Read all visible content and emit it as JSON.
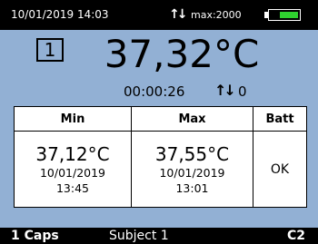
{
  "status_bar": {
    "datetime": "10/01/2019  14:03",
    "arrows": "↑↓",
    "max_label": "max:2000",
    "battery_level": 0.7,
    "battery_color": "#2fd12f"
  },
  "main": {
    "channel": "1",
    "temperature": "37,32°C",
    "timer": "00:00:26",
    "counter_arrows": "↑↓",
    "counter_value": "0"
  },
  "table": {
    "headers": [
      "Min",
      "Max",
      "Batt"
    ],
    "min": {
      "temp": "37,12°C",
      "date": "10/01/2019",
      "time": "13:45"
    },
    "max": {
      "temp": "37,55°C",
      "date": "10/01/2019",
      "time": "13:01"
    },
    "batt": "OK"
  },
  "bottom_bar": {
    "left": "1 Caps",
    "middle": "Subject 1",
    "right": "C2"
  },
  "colors": {
    "background": "#92b0d4",
    "bar": "#000000"
  }
}
